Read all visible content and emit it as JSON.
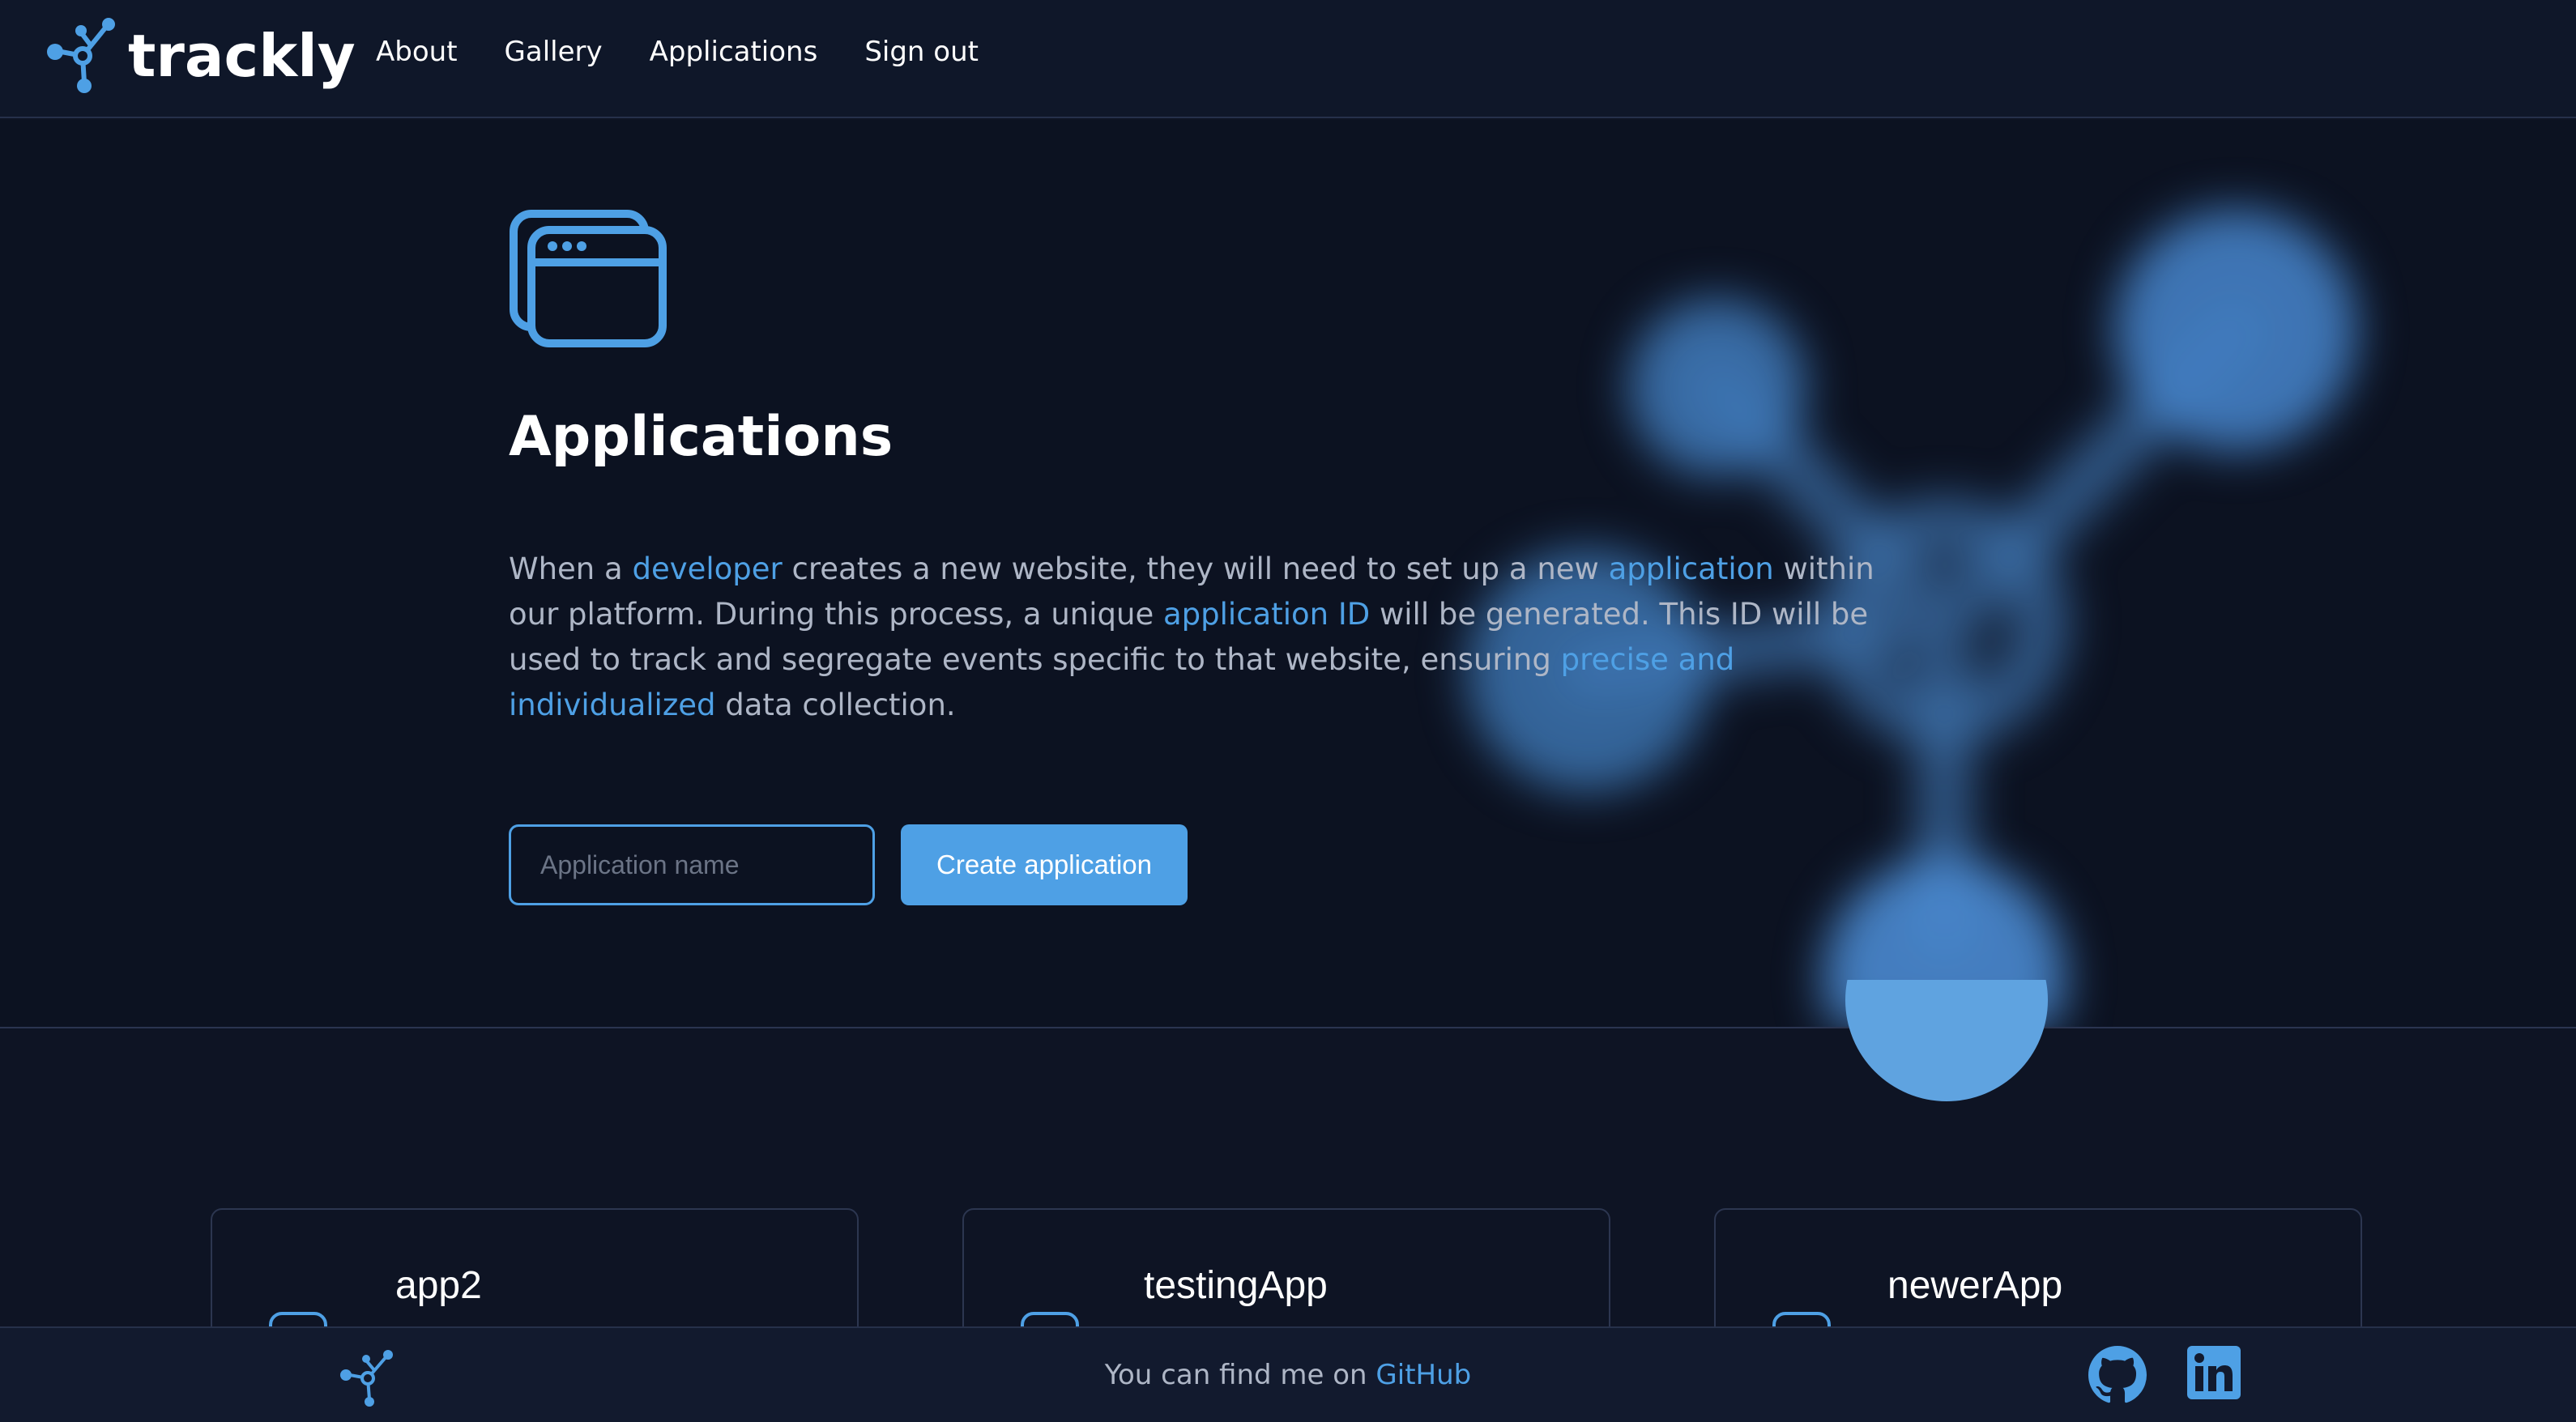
{
  "brand": {
    "name": "trackly",
    "logo_icon": "network-node-icon"
  },
  "nav": {
    "items": [
      "About",
      "Gallery",
      "Applications",
      "Sign out"
    ]
  },
  "hero": {
    "icon": "browser-windows-icon",
    "title": "Applications",
    "description": {
      "p1": "When a ",
      "h1": "developer",
      "p2": " creates a new website, they will need to set up a new ",
      "h2": "application",
      "p3": " within our platform. During this process, a unique ",
      "h3": "application ID",
      "p4": " will be generated. This ID will be used to track and segregate events specific to that website, ensuring ",
      "h4": "precise and individualized",
      "p5": " data collection."
    }
  },
  "form": {
    "input_placeholder": "Application name",
    "input_value": "",
    "create_label": "Create application"
  },
  "applications": [
    {
      "name": "app2"
    },
    {
      "name": "testingApp"
    },
    {
      "name": "newerApp"
    }
  ],
  "footer": {
    "text": "You can find me on ",
    "link": "GitHub",
    "icons": [
      "trackly-logo-icon",
      "github-icon",
      "linkedin-icon"
    ]
  },
  "colors": {
    "accent": "#4ea0e5",
    "background": "#0c1221",
    "header": "#0f1729"
  }
}
